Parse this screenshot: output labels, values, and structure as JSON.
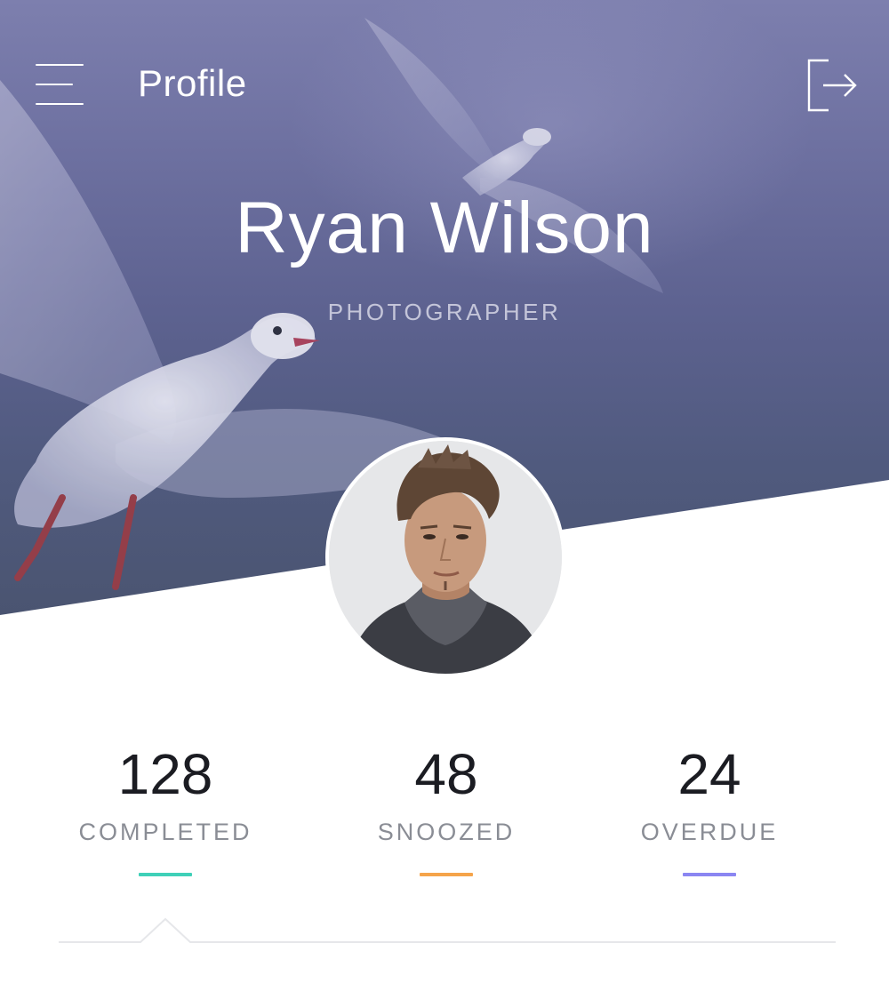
{
  "header": {
    "title": "Profile",
    "menu_icon": "hamburger-menu-icon",
    "logout_icon": "logout-icon"
  },
  "profile": {
    "name": "Ryan Wilson",
    "role": "PHOTOGRAPHER",
    "avatar": "avatar"
  },
  "stats": [
    {
      "value": "128",
      "label": "COMPLETED",
      "color": "#3fd0b8"
    },
    {
      "value": "48",
      "label": "SNOOZED",
      "color": "#f5a44a"
    },
    {
      "value": "24",
      "label": "OVERDUE",
      "color": "#8b86f2"
    }
  ],
  "colors": {
    "hero_top": "#7d7fae",
    "hero_bottom": "#4a5470",
    "text_dark": "#1b1c22",
    "text_muted": "#8a8d95"
  }
}
